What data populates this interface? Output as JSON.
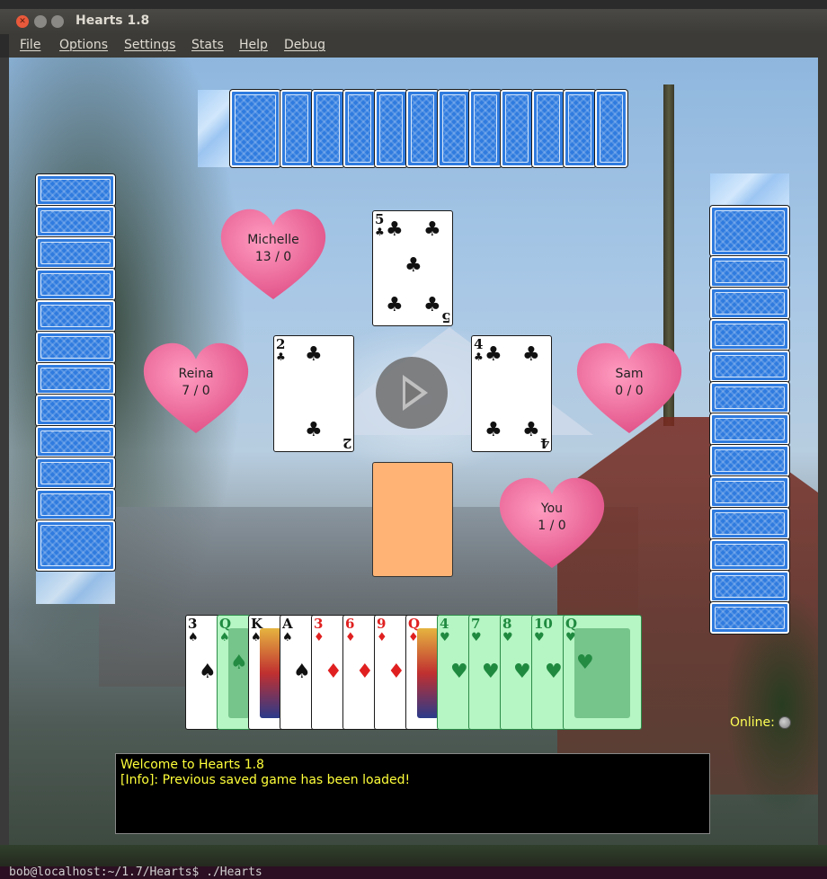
{
  "window": {
    "title": "Hearts 1.8"
  },
  "menu": [
    "File",
    "Options",
    "Settings",
    "Stats",
    "Help",
    "Debug"
  ],
  "players": [
    {
      "name": "Michelle",
      "score": "13 / 0"
    },
    {
      "name": "Reina",
      "score": "7 / 0"
    },
    {
      "name": "Sam",
      "score": "0 / 0"
    },
    {
      "name": "You",
      "score": "1 / 0"
    }
  ],
  "trick": {
    "top": {
      "rank": "5",
      "suit": "♣"
    },
    "left": {
      "rank": "2",
      "suit": "♣"
    },
    "right": {
      "rank": "4",
      "suit": "♣"
    }
  },
  "hand": [
    {
      "rank": "3",
      "suit": "♠",
      "color": "black",
      "playable": false
    },
    {
      "rank": "Q",
      "suit": "♠",
      "color": "black",
      "playable": true
    },
    {
      "rank": "K",
      "suit": "♠",
      "color": "black",
      "playable": false
    },
    {
      "rank": "A",
      "suit": "♠",
      "color": "black",
      "playable": false
    },
    {
      "rank": "3",
      "suit": "♦",
      "color": "red",
      "playable": false
    },
    {
      "rank": "6",
      "suit": "♦",
      "color": "red",
      "playable": false
    },
    {
      "rank": "9",
      "suit": "♦",
      "color": "red",
      "playable": false
    },
    {
      "rank": "Q",
      "suit": "♦",
      "color": "red",
      "playable": false
    },
    {
      "rank": "4",
      "suit": "♥",
      "color": "red",
      "playable": true
    },
    {
      "rank": "7",
      "suit": "♥",
      "color": "red",
      "playable": true
    },
    {
      "rank": "8",
      "suit": "♥",
      "color": "red",
      "playable": true
    },
    {
      "rank": "10",
      "suit": "♥",
      "color": "red",
      "playable": true
    },
    {
      "rank": "Q",
      "suit": "♥",
      "color": "red",
      "playable": true
    }
  ],
  "status": {
    "online_label": "Online:"
  },
  "console": [
    "Welcome to Hearts 1.8",
    "[Info]: Previous saved game has been loaded!"
  ],
  "terminal": "bob@localhost:~/1.7/Hearts$ ./Hearts",
  "colors": {
    "card_back": "#2f7bdf",
    "heart": "#ee5f95",
    "console_text": "#ffff3a",
    "selected_card": "#b6f5c4",
    "empty_slot": "#ffb374"
  }
}
